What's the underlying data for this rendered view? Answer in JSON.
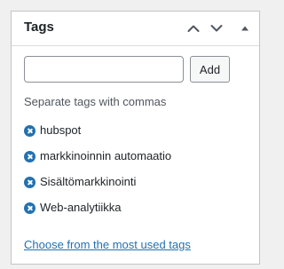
{
  "panel": {
    "title": "Tags",
    "move_up_icon": "chevron-up-icon",
    "move_down_icon": "chevron-down-icon",
    "toggle_icon": "triangle-up-icon"
  },
  "input": {
    "value": "",
    "placeholder": ""
  },
  "add_button": "Add",
  "hint": "Separate tags with commas",
  "tags": [
    {
      "label": "hubspot"
    },
    {
      "label": "markkinoinnin automaatio"
    },
    {
      "label": "Sisältömarkkinointi"
    },
    {
      "label": "Web-analytiikka"
    }
  ],
  "most_used_link": "Choose from the most used tags",
  "colors": {
    "accent": "#2271b1",
    "border": "#c3c4c7",
    "background": "#f0f0f1"
  }
}
